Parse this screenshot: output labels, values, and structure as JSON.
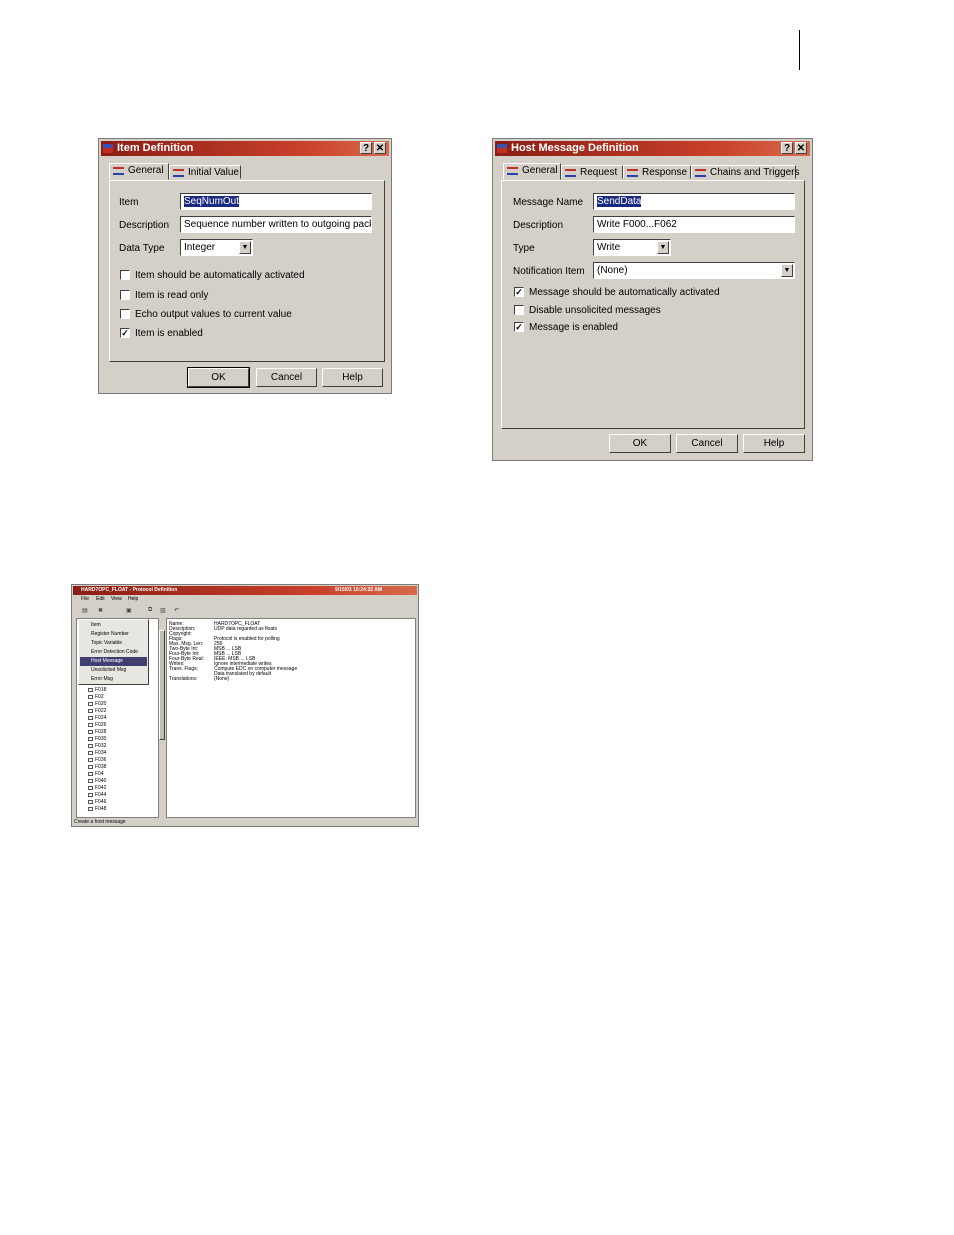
{
  "item_definition": {
    "title": "Item Definition",
    "help_btn": "?",
    "close_btn": "✕",
    "tabs": [
      {
        "label": "General",
        "active": true
      },
      {
        "label": "Initial Value",
        "active": false
      }
    ],
    "item_label": "Item",
    "item_value": "SeqNumOut",
    "description_label": "Description",
    "description_value": "Sequence number written to outgoing packets",
    "data_type_label": "Data Type",
    "data_type_value": "Integer",
    "checkboxes": [
      {
        "label": "Item should be automatically activated",
        "checked": false
      },
      {
        "label": "Item is read only",
        "checked": false
      },
      {
        "label": "Echo output values to current value",
        "checked": false
      },
      {
        "label": "Item is enabled",
        "checked": true
      }
    ],
    "buttons": {
      "ok": "OK",
      "cancel": "Cancel",
      "help": "Help"
    }
  },
  "host_message_definition": {
    "title": "Host Message Definition",
    "help_btn": "?",
    "close_btn": "✕",
    "tabs": [
      {
        "label": "General",
        "active": true
      },
      {
        "label": "Request",
        "active": false
      },
      {
        "label": "Response",
        "active": false
      },
      {
        "label": "Chains and Triggers",
        "active": false
      }
    ],
    "message_name_label": "Message Name",
    "message_name_value": "SendData",
    "description_label": "Description",
    "description_value": "Write F000...F062",
    "type_label": "Type",
    "type_value": "Write",
    "notification_item_label": "Notification Item",
    "notification_item_value": "(None)",
    "checkboxes": [
      {
        "label": "Message should be automatically activated",
        "checked": true
      },
      {
        "label": "Disable unsolicited messages",
        "checked": false
      },
      {
        "label": "Message is enabled",
        "checked": true
      }
    ],
    "buttons": {
      "ok": "OK",
      "cancel": "Cancel",
      "help": "Help"
    }
  },
  "protocol_definition": {
    "title": "HARD7OPC_FLOAT - Protocol Definition",
    "datetime": "9/15/03 10:24:32 AM",
    "menu": [
      "File",
      "Edit",
      "View",
      "Help"
    ],
    "context_menu": [
      "Item",
      "Register Number",
      "Topic Variable",
      "Error Detection Code",
      "Host Message",
      "Unsolicited Msg",
      "Error Msg"
    ],
    "highlighted_menu_item": "Host Message",
    "tree_items": [
      "F018",
      "F02",
      "F020",
      "F022",
      "F024",
      "F026",
      "F028",
      "F030",
      "F032",
      "F034",
      "F036",
      "F038",
      "F04",
      "F040",
      "F042",
      "F044",
      "F046",
      "F048"
    ],
    "properties": [
      {
        "key": "Name:",
        "value": "HARD7OPC_FLOAT"
      },
      {
        "key": "Description:",
        "value": "UDP data regarded as floats"
      },
      {
        "key": "Copyright:",
        "value": ""
      },
      {
        "key": "Flags:",
        "value": "Protocol is enabled for polling"
      },
      {
        "key": "Max. Msg. Len:",
        "value": "256"
      },
      {
        "key": "Two-Byte Int:",
        "value": "MSB ... LSB"
      },
      {
        "key": "Four-Byte Int:",
        "value": "MSB ... LSB"
      },
      {
        "key": "Four-Byte Real:",
        "value": "IEEE: MSB ... LSB"
      },
      {
        "key": "Writes:",
        "value": "Ignore intermediate writes"
      },
      {
        "key": "Trans. Flags:",
        "value": "Compute EDC on computer message"
      },
      {
        "key": "",
        "value": "Data translated by default"
      },
      {
        "key": "Translations:",
        "value": "(None)"
      }
    ],
    "status": "Create a host message"
  }
}
